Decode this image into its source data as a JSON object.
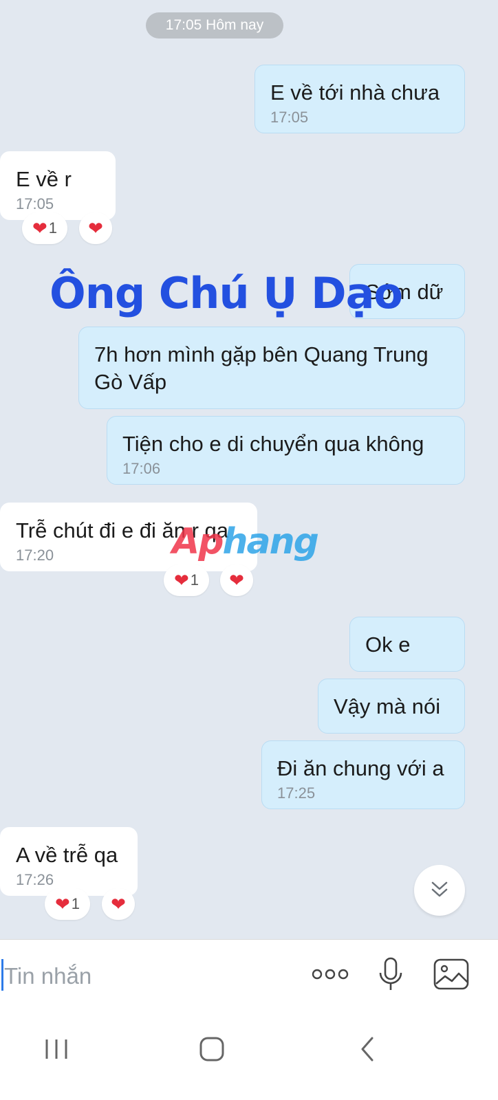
{
  "date_separator": "17:05 Hôm nay",
  "messages": [
    {
      "text": "E về tới nhà chưa",
      "time": "17:05"
    },
    {
      "text": "E về r",
      "time": "17:05",
      "reaction_count": "1"
    },
    {
      "text": "Sớm dữ"
    },
    {
      "text": "7h hơn mình gặp bên Quang Trung Gò Vấp"
    },
    {
      "text": "Tiện cho e di chuyển qua không",
      "time": "17:06"
    },
    {
      "text": "Trễ chút đi e đi ăn r qa",
      "time": "17:20",
      "reaction_count": "1"
    },
    {
      "text": "Ok e"
    },
    {
      "text": "Vậy mà nói"
    },
    {
      "text": "Đi ăn chung với a",
      "time": "17:25"
    },
    {
      "text": "A về trễ qa",
      "time": "17:26",
      "reaction_count": "1"
    }
  ],
  "watermark": "Ông Chú Ụ Dạo",
  "logo": {
    "part1": "Ap",
    "part2": "hang"
  },
  "input": {
    "placeholder": "Tin nhắn"
  },
  "icons": {
    "reaction": "heart-icon",
    "scroll": "double-chevron-down-icon",
    "more": "more-dots-icon",
    "mic": "microphone-icon",
    "gallery": "image-gallery-icon",
    "nav_recent": "recent-apps-icon",
    "nav_home": "home-icon",
    "nav_back": "back-icon"
  },
  "colors": {
    "background": "#e2e8f0",
    "outgoing_bubble": "#d5eefc",
    "incoming_bubble": "#ffffff",
    "heart": "#e52d3c",
    "watermark": "#2350e0",
    "cursor": "#2d7be8"
  }
}
